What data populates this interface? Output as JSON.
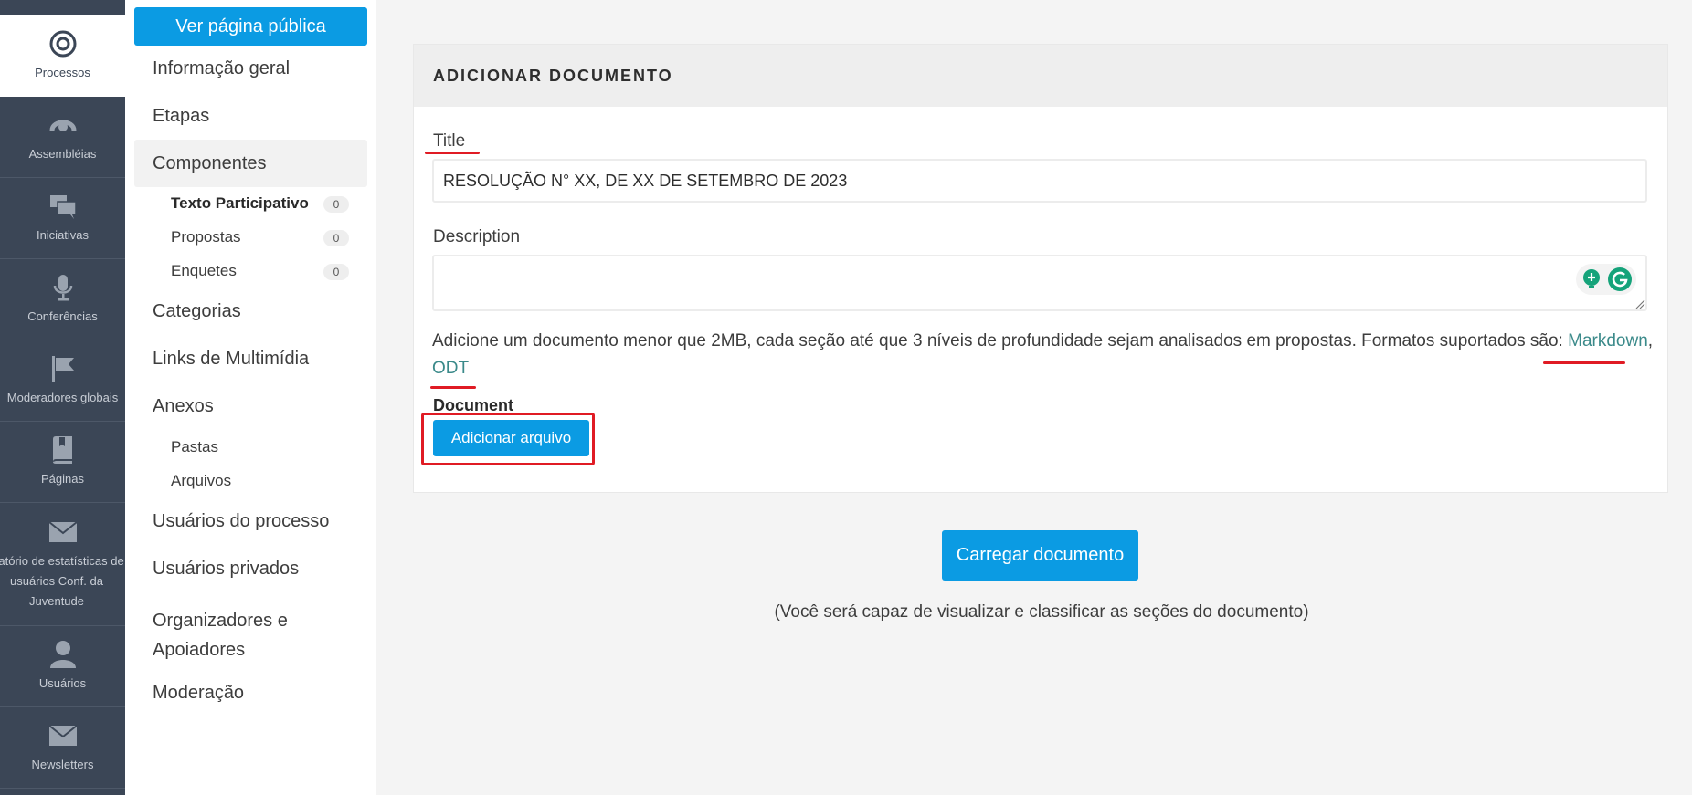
{
  "rail": {
    "items": [
      {
        "label": "Processos",
        "icon": "target-icon",
        "active": true
      },
      {
        "label": "Assembléias",
        "icon": "assembly-icon"
      },
      {
        "label": "Iniciativas",
        "icon": "chat-bubbles-icon"
      },
      {
        "label": "Conferências",
        "icon": "microphone-icon"
      },
      {
        "label": "Moderadores globais",
        "icon": "flag-icon"
      },
      {
        "label": "Páginas",
        "icon": "book-icon"
      },
      {
        "label": "elatório de estatísticas de usuários Conf. da Juventude",
        "icon": "mail-icon"
      },
      {
        "label": "Usuários",
        "icon": "user-icon"
      },
      {
        "label": "Newsletters",
        "icon": "mail-icon"
      }
    ]
  },
  "sidebar": {
    "public_button": "Ver página pública",
    "items": {
      "info": "Informação geral",
      "steps": "Etapas",
      "components": "Componentes",
      "categories": "Categorias",
      "media_links": "Links de Multimídia",
      "attachments": "Anexos",
      "process_users": "Usuários do processo",
      "private_users": "Usuários privados",
      "organizers": "Organizadores e Apoiadores",
      "moderation": "Moderação"
    },
    "components_sub": [
      {
        "label": "Texto Participativo",
        "count": "0",
        "bold": true
      },
      {
        "label": "Propostas",
        "count": "0"
      },
      {
        "label": "Enquetes",
        "count": "0"
      }
    ],
    "attachments_sub": {
      "folders": "Pastas",
      "files": "Arquivos"
    }
  },
  "form": {
    "header": "ADICIONAR DOCUMENTO",
    "title_label": "Title",
    "title_value": "RESOLUÇÃO N° XX, DE XX DE SETEMBRO DE 2023",
    "description_label": "Description",
    "description_value": "",
    "help_text": "Adicione um documento menor que 2MB, cada seção até que 3 níveis de profundidade sejam analisados em propostas. Formatos suportados são: ",
    "format_markdown": "Markdown",
    "format_sep": ",",
    "format_odt": "ODT",
    "document_label": "Document",
    "add_file_button": "Adicionar arquivo"
  },
  "actions": {
    "load_button": "Carregar documento",
    "note": "(Você será capaz de visualizar e classificar as seções do documento)"
  },
  "colors": {
    "accent": "#0b9be3",
    "rail": "#3b4656",
    "annotation": "#e01b24",
    "link": "#3b8a8a"
  }
}
